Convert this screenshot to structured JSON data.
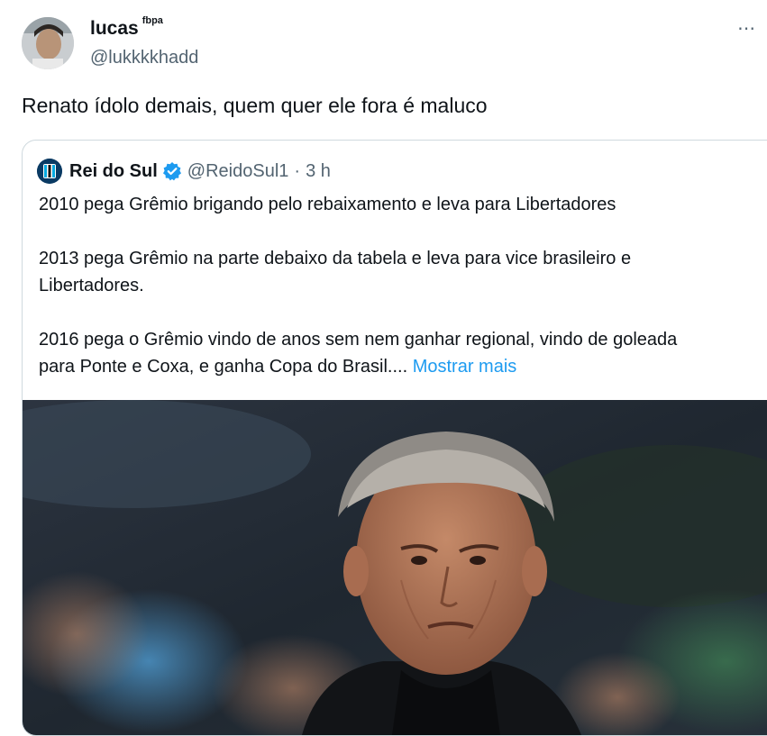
{
  "tweet": {
    "author_name": "lucas",
    "author_badge_text": "fbpa",
    "author_handle": "@lukkkkhadd",
    "text": "Renato ídolo demais, quem quer ele fora é maluco",
    "more_icon": "more-horizontal-icon"
  },
  "quote": {
    "author_name": "Rei do Sul",
    "verified_icon": "verified-badge-icon",
    "author_handle": "@ReidoSul1",
    "separator": "·",
    "time": "3 h",
    "paragraphs": [
      "2010 pega Grêmio brigando pelo rebaixamento e leva para Libertadores",
      "2013 pega Grêmio na parte debaixo da tabela e leva para vice brasileiro e",
      "Libertadores.",
      "2016 pega o Grêmio vindo de anos sem nem ganhar regional, vindo de goleada",
      "para Ponte e Coxa, e ganha Copa do Brasil...."
    ],
    "show_more": "Mostrar mais",
    "colors": {
      "link": "#1d9bf0",
      "secondary": "#536471",
      "border": "#cfd9de"
    }
  }
}
